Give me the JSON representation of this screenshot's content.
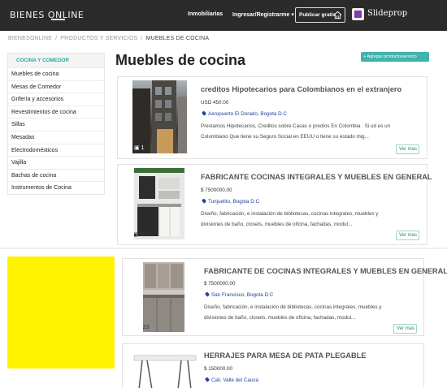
{
  "header": {
    "logo": "BIENES ONLINE",
    "nav": {
      "inmobiliarias": "Inmobiliarias",
      "login": "Ingresar/Registrarme ▾"
    },
    "publish_label": "Publicar gratis",
    "partner": "Slideprop"
  },
  "breadcrumb": [
    "BIENESONLINE",
    "PRODUCTOS Y SERVICIOS",
    "MUEBLES DE COCINA"
  ],
  "sidebar": {
    "heading": "COCINA Y COMEDOR",
    "items": [
      {
        "label": "Muebles de cocina"
      },
      {
        "label": "Mesas de Comedor"
      },
      {
        "label": "Grifería y accesorios"
      },
      {
        "label": "Revestimientos de cocina"
      },
      {
        "label": "Sillas"
      },
      {
        "label": "Mesadas"
      },
      {
        "label": "Electrodomésticos"
      },
      {
        "label": "Vajilla"
      },
      {
        "label": "Bachas de cocina"
      },
      {
        "label": "Instrumentos de Cocina"
      }
    ]
  },
  "main": {
    "title": "Muebles de cocina",
    "add_button": "+ Agregar producto/servicio",
    "listings": [
      {
        "title": "creditos Hipotecarios para Colombianos en el extranjero",
        "price": "USD 450.00",
        "location": "Aeropuerto El Dorado, Bogota D.C",
        "desc1": "Prestamos Hipotecarios, Creditos sobre Casas o predios En Colombia . Si ud es un",
        "desc2": "Colombiano Que tiene su Seguro Social en EEUU o tiene su estado mig...",
        "photos": "1",
        "more": "Ver mas"
      },
      {
        "title": "FABRICANTE COCINAS INTEGRALES Y MUEBLES EN GENERAL",
        "price": "$ 7500000.00",
        "location": "Tunjuelito, Bogota D.C",
        "desc1": "Diseño, fabricación, e instalación de bibliotecas, cocinas integrales, muebles y",
        "desc2": "divisiones de baño, closets, muebles de oficina, fachadas, modul...",
        "photos": "29",
        "more": "Ver mas"
      },
      {
        "title": "FABRICANTE DE COCINAS INTEGRALES Y MUEBLES EN GENERAL",
        "price": "$ 7500000.00",
        "location": "San Francisco, Bogota D.C",
        "desc1": "Diseño, fabricación, e instalación de bibliotecas, cocinas integrales, muebles y",
        "desc2": "divisiones de baño, closets, muebles de oficina, fachadas, modul...",
        "photos": "23",
        "more": "Ver mas"
      },
      {
        "title": "HERRAJES PARA MESA DE PATA PLEGABLE",
        "price": "$ 150000.00",
        "location": "Cali, Valle del Cauca"
      }
    ]
  },
  "colors": {
    "topbar": "#2b2b2b",
    "accent": "#3fb3ad",
    "ad": "#fff200",
    "link": "#2140a0"
  }
}
